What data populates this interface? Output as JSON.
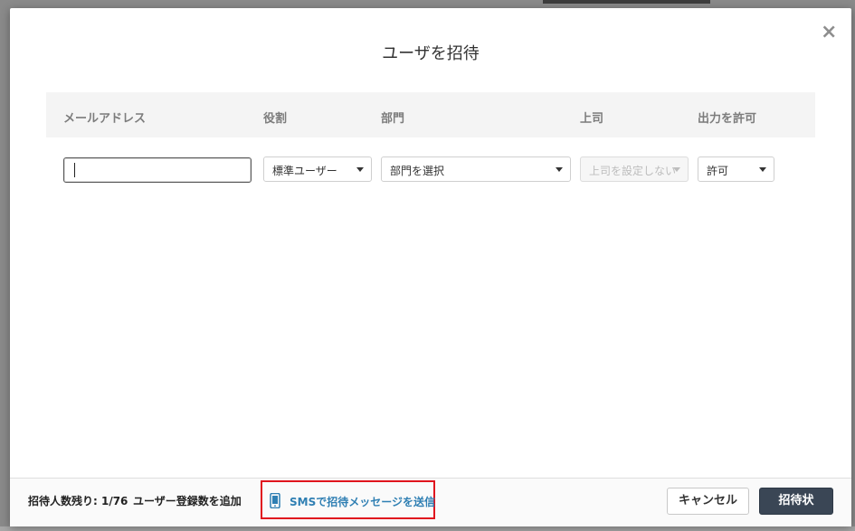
{
  "modal": {
    "title": "ユーザを招待"
  },
  "table": {
    "headers": [
      "メールアドレス",
      "役割",
      "部門",
      "上司",
      "出力を許可"
    ]
  },
  "row": {
    "email_value": "",
    "role": "標準ユーザー",
    "department": "部門を選択",
    "manager": "上司を設定しない",
    "export_permission": "許可"
  },
  "footer": {
    "remaining_label": "招待人数残り: 1/76",
    "add_registrations": "ユーザー登録数を追加",
    "sms_link": "SMSで招待メッセージを送信",
    "cancel": "キャンセル",
    "invite": "招待状"
  },
  "colors": {
    "primary_button": "#3a4655",
    "link": "#2f7fb3",
    "highlight_box": "#e0141e"
  },
  "icons": {
    "close": "close-icon",
    "sms": "phone-icon"
  }
}
